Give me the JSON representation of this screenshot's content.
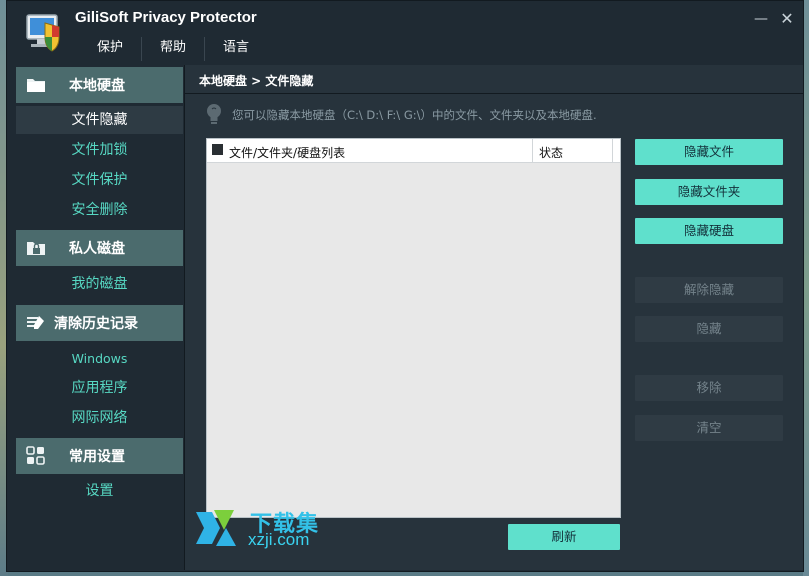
{
  "app": {
    "title": "GiliSoft Privacy Protector",
    "window_controls": {
      "minimize": "—",
      "close": "✕"
    }
  },
  "menu": {
    "items": [
      "保护",
      "帮助",
      "语言"
    ]
  },
  "sidebar": {
    "sections": [
      {
        "title": "本地硬盘",
        "icon": "folder-icon",
        "items": [
          "文件隐藏",
          "文件加锁",
          "文件保护",
          "安全删除"
        ]
      },
      {
        "title": "私人磁盘",
        "icon": "lock-folder-icon",
        "items": [
          "我的磁盘"
        ]
      },
      {
        "title": "清除历史记录",
        "icon": "brush-icon",
        "items": [
          "Windows",
          "应用程序",
          "网际网络"
        ]
      },
      {
        "title": "常用设置",
        "icon": "grid-settings-icon",
        "items": [
          "设置"
        ]
      }
    ],
    "active_item": "文件隐藏"
  },
  "main": {
    "breadcrumb": "本地硬盘 > 文件隐藏",
    "hint": "您可以隐藏本地硬盘（C:\\ D:\\ F:\\ G:\\）中的文件、文件夹以及本地硬盘.",
    "list": {
      "columns": [
        "文件/文件夹/硬盘列表",
        "状态"
      ],
      "rows": []
    },
    "buttons": {
      "hide_file": "隐藏文件",
      "hide_folder": "隐藏文件夹",
      "hide_disk": "隐藏硬盘",
      "unhide": "解除隐藏",
      "hide": "隐藏",
      "remove": "移除",
      "clear": "清空",
      "refresh": "刷新"
    }
  },
  "watermark": {
    "line1": "下载集",
    "line2": "xzji.com"
  },
  "colors": {
    "accent": "#5fe0cc",
    "sidebar_header": "#4b6b6d",
    "link": "#57d8c3",
    "window_bg": "#1f2a33"
  }
}
